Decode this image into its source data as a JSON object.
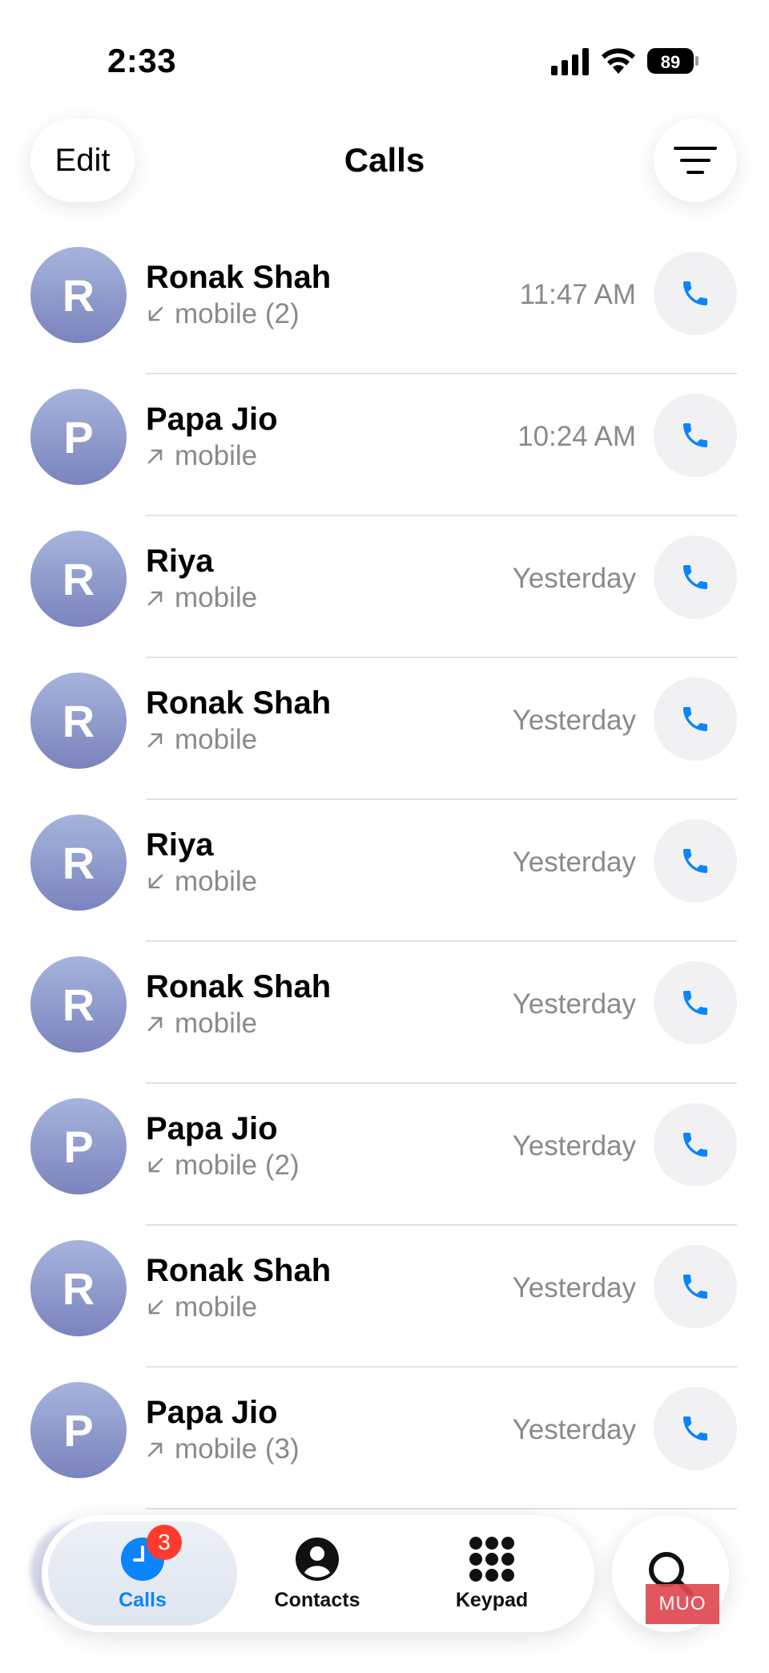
{
  "status_bar": {
    "time": "2:33",
    "battery_level": "89",
    "signal_icon": "cellular-signal-icon",
    "wifi_icon": "wifi-icon"
  },
  "header": {
    "edit_label": "Edit",
    "title": "Calls",
    "filter_icon": "filter-lines-icon"
  },
  "colors": {
    "accent": "#0a84ff",
    "badge": "#ff3b30",
    "secondary_text": "#8a8a8e",
    "avatar_top": "#a6b4dc",
    "avatar_bottom": "#7b83bd"
  },
  "calls": [
    {
      "initial": "R",
      "name": "Ronak Shah",
      "direction": "incoming",
      "detail": "mobile (2)",
      "time": "11:47 AM"
    },
    {
      "initial": "P",
      "name": "Papa Jio",
      "direction": "outgoing",
      "detail": "mobile",
      "time": "10:24 AM"
    },
    {
      "initial": "R",
      "name": "Riya",
      "direction": "outgoing",
      "detail": "mobile",
      "time": "Yesterday"
    },
    {
      "initial": "R",
      "name": "Ronak Shah",
      "direction": "outgoing",
      "detail": "mobile",
      "time": "Yesterday"
    },
    {
      "initial": "R",
      "name": "Riya",
      "direction": "incoming",
      "detail": "mobile",
      "time": "Yesterday"
    },
    {
      "initial": "R",
      "name": "Ronak Shah",
      "direction": "outgoing",
      "detail": "mobile",
      "time": "Yesterday"
    },
    {
      "initial": "P",
      "name": "Papa Jio",
      "direction": "incoming",
      "detail": "mobile (2)",
      "time": "Yesterday"
    },
    {
      "initial": "R",
      "name": "Ronak Shah",
      "direction": "incoming",
      "detail": "mobile",
      "time": "Yesterday"
    },
    {
      "initial": "P",
      "name": "Papa Jio",
      "direction": "outgoing",
      "detail": "mobile (3)",
      "time": "Yesterday"
    }
  ],
  "tab_bar": {
    "calls_label": "Calls",
    "calls_badge": "3",
    "contacts_label": "Contacts",
    "keypad_label": "Keypad",
    "search_icon": "search-icon"
  },
  "watermark": "MUO"
}
